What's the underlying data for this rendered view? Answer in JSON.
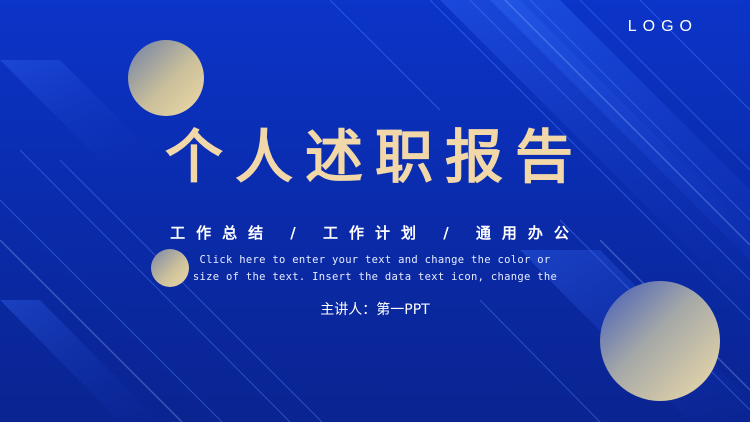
{
  "logo": "LOGO",
  "title": "个人述职报告",
  "subtitle": "工作总结 / 工作计划 / 通用办公",
  "description": {
    "line1": "Click here to enter your text and change the color or",
    "line2": "size of the text. Insert the data text icon, change the"
  },
  "presenter": "主讲人：第一PPT",
  "colors": {
    "background": "#0b34c8",
    "title": "#f2d8a8",
    "circle_gold": "#efd9a6"
  }
}
